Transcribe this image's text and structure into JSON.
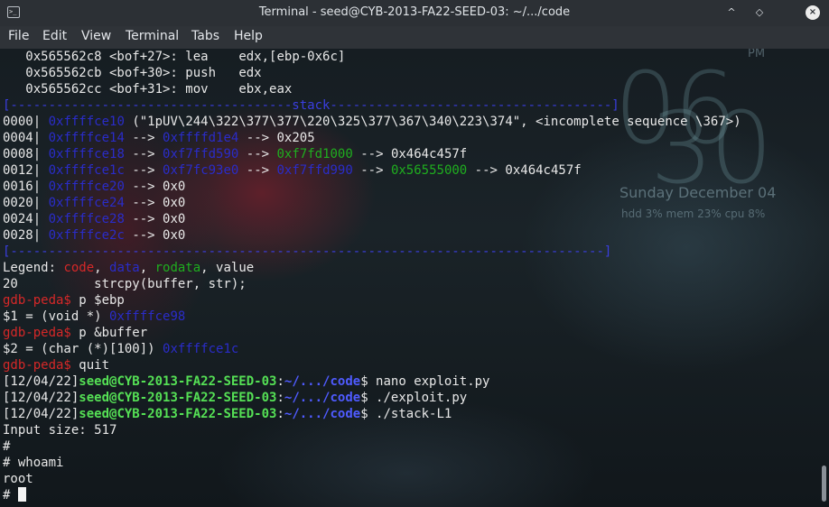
{
  "window": {
    "title": "Terminal - seed@CYB-2013-FA22-SEED-03: ~/.../code",
    "icon": "terminal-icon",
    "buttons": {
      "minimize": "^",
      "restore": "◇",
      "close": "×"
    }
  },
  "menu": [
    "File",
    "Edit",
    "View",
    "Terminal",
    "Tabs",
    "Help"
  ],
  "background": {
    "clock_digits": "06",
    "clock_digits2": "30",
    "ampm": "PM",
    "date": "Sunday   December 04",
    "stats": "hdd  3%   mem  23%  cpu    8%"
  },
  "terminal": {
    "code_lines": [
      {
        "addr": "   0x565562c8",
        "func": " <bof+27>:",
        "op": " lea    ",
        "args": "edx,[ebp-0x6c]"
      },
      {
        "addr": "   0x565562cb",
        "func": " <bof+30>:",
        "op": " push   ",
        "args": "edx"
      },
      {
        "addr": "   0x565562cc",
        "func": " <bof+31>:",
        "op": " mov    ",
        "args": "ebx,eax"
      }
    ],
    "stack_header": "[-------------------------------------stack-------------------------------------]",
    "stack": [
      {
        "off": "0000|",
        "addr": "0xffffce10",
        "rest": " (\"1pUV\\244\\322\\377\\377\\220\\325\\377\\367\\340\\223\\374\", <incomplete sequence \\367>)"
      },
      {
        "off": "0004|",
        "addr": "0xffffce14",
        "a1": " --> ",
        "p1": "0xffffd1e4",
        "a2": " --> ",
        "v": "0x205"
      },
      {
        "off": "0008|",
        "addr": "0xffffce18",
        "a1": " --> ",
        "p1": "0xf7ffd590",
        "a2": " --> ",
        "p2": "0xf7fd1000",
        "a3": " --> ",
        "v": "0x464c457f"
      },
      {
        "off": "0012|",
        "addr": "0xffffce1c",
        "a1": " --> ",
        "p1": "0xf7fc93e0",
        "a2": " --> ",
        "p2": "0xf7ffd990",
        "a3": " --> ",
        "p3": "0x56555000",
        "a4": " --> ",
        "v": "0x464c457f"
      },
      {
        "off": "0016|",
        "addr": "0xffffce20",
        "a1": " --> ",
        "v": "0x0"
      },
      {
        "off": "0020|",
        "addr": "0xffffce24",
        "a1": " --> ",
        "v": "0x0"
      },
      {
        "off": "0024|",
        "addr": "0xffffce28",
        "a1": " --> ",
        "v": "0x0"
      },
      {
        "off": "0028|",
        "addr": "0xffffce2c",
        "a1": " --> ",
        "v": "0x0"
      }
    ],
    "stack_footer": "[------------------------------------------------------------------------------]",
    "legend": {
      "label": "Legend: ",
      "code": "code",
      "sep1": ", ",
      "data": "data",
      "sep2": ", ",
      "rodata": "rodata",
      "sep3": ", ",
      "value": "value"
    },
    "src_line": "20          strcpy(buffer, str);",
    "prompt": "gdb-peda$",
    "cmd1": " p $ebp",
    "out1_pre": "$1 = (void *) ",
    "out1_val": "0xffffce98",
    "cmd2": " p &buffer",
    "out2_pre": "$2 = (char (*)[100]) ",
    "out2_val": "0xffffce1c",
    "cmd3": " quit",
    "shell_date": "[12/04/22]",
    "shell_user": "seed@CYB-2013-FA22-SEED-03",
    "shell_colon": ":",
    "shell_path": "~/.../code",
    "shell_dollar": "$",
    "sh_cmd1": " nano exploit.py",
    "sh_cmd2": " ./exploit.py",
    "sh_cmd3": " ./stack-L1",
    "out_size": "Input size: 517",
    "root1": "#",
    "root2": "# whoami",
    "out_root": "root",
    "root3": "# "
  }
}
